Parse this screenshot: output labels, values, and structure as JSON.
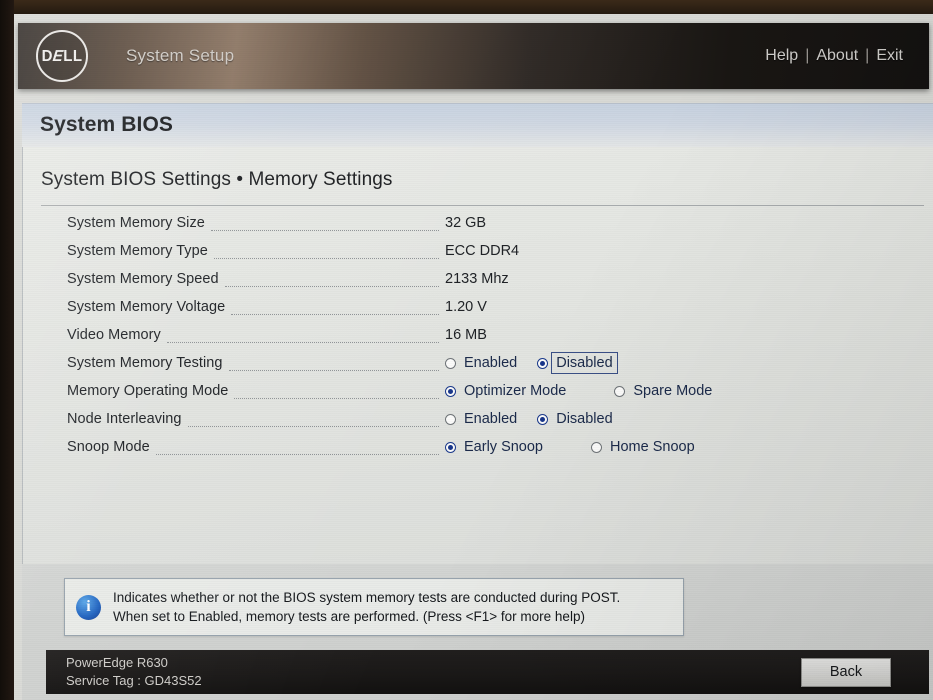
{
  "header": {
    "logo_text_1": "D",
    "logo_text_2": "E",
    "logo_text_3": "LL",
    "app_title": "System Setup",
    "nav": {
      "help": "Help",
      "sep1": "|",
      "about": "About",
      "sep2": "|",
      "exit": "Exit"
    }
  },
  "page": {
    "title": "System BIOS",
    "breadcrumb": "System BIOS Settings • Memory Settings"
  },
  "settings": {
    "rows": [
      {
        "label": "System Memory Size",
        "value": "32 GB"
      },
      {
        "label": "System Memory Type",
        "value": "ECC DDR4"
      },
      {
        "label": "System Memory Speed",
        "value": "2133 Mhz"
      },
      {
        "label": "System Memory Voltage",
        "value": "1.20 V"
      },
      {
        "label": "Video Memory",
        "value": "16 MB"
      },
      {
        "label": "System Memory Testing",
        "option_a": "Enabled",
        "option_b": "Disabled",
        "selected": "Disabled",
        "focused": "Disabled"
      },
      {
        "label": "Memory Operating Mode",
        "option_a": "Optimizer Mode",
        "option_b": "Spare Mode",
        "selected": "Optimizer Mode"
      },
      {
        "label": "Node Interleaving",
        "option_a": "Enabled",
        "option_b": "Disabled",
        "selected": "Disabled"
      },
      {
        "label": "Snoop Mode",
        "option_a": "Early Snoop",
        "option_b": "Home Snoop",
        "selected": "Early Snoop"
      }
    ]
  },
  "help": {
    "icon": "info-icon",
    "glyph": "i",
    "line1": "Indicates whether or not the BIOS system memory tests are conducted during POST.",
    "line2": "When set to Enabled, memory tests are performed. (Press <F1> for more help)"
  },
  "footer": {
    "model": "PowerEdge R630",
    "service_tag": "Service Tag : GD43S52",
    "back_label": "Back"
  },
  "colors": {
    "accent_blue": "#17358a",
    "info_blue": "#1f62c0",
    "screen_bg": "#e3e5e1",
    "header_dark": "#1a1817"
  }
}
